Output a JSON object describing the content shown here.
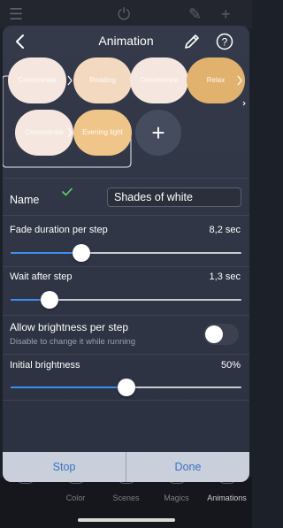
{
  "background_tabs": [
    {
      "label": ""
    },
    {
      "label": "Color"
    },
    {
      "label": "Scenes"
    },
    {
      "label": "Magics"
    },
    {
      "label": "Animations"
    }
  ],
  "header": {
    "title": "Animation"
  },
  "steps": [
    {
      "label": "Concentrate",
      "color": "#f5e6df"
    },
    {
      "label": "Reading",
      "color": "#f3d9bf"
    },
    {
      "label": "Concentrate",
      "color": "#f5e6df"
    },
    {
      "label": "Relax",
      "color": "#e1b26e"
    },
    {
      "label": "Concentrate",
      "color": "#f5e6df"
    },
    {
      "label": "Evening light",
      "color": "#f0c58a"
    }
  ],
  "add_step_symbol": "+",
  "name": {
    "label": "Name",
    "value": "Shades of white"
  },
  "fade": {
    "label": "Fade duration per step",
    "value": "8,2 sec",
    "fraction": 0.29
  },
  "wait": {
    "label": "Wait after step",
    "value": "1,3 sec",
    "fraction": 0.14
  },
  "allow_brightness": {
    "label": "Allow brightness per step",
    "sublabel": "Disable to change it while running",
    "enabled": false
  },
  "initial_brightness": {
    "label": "Initial brightness",
    "value": "50%",
    "fraction": 0.5
  },
  "footer": {
    "stop_label": "Stop",
    "done_label": "Done"
  }
}
